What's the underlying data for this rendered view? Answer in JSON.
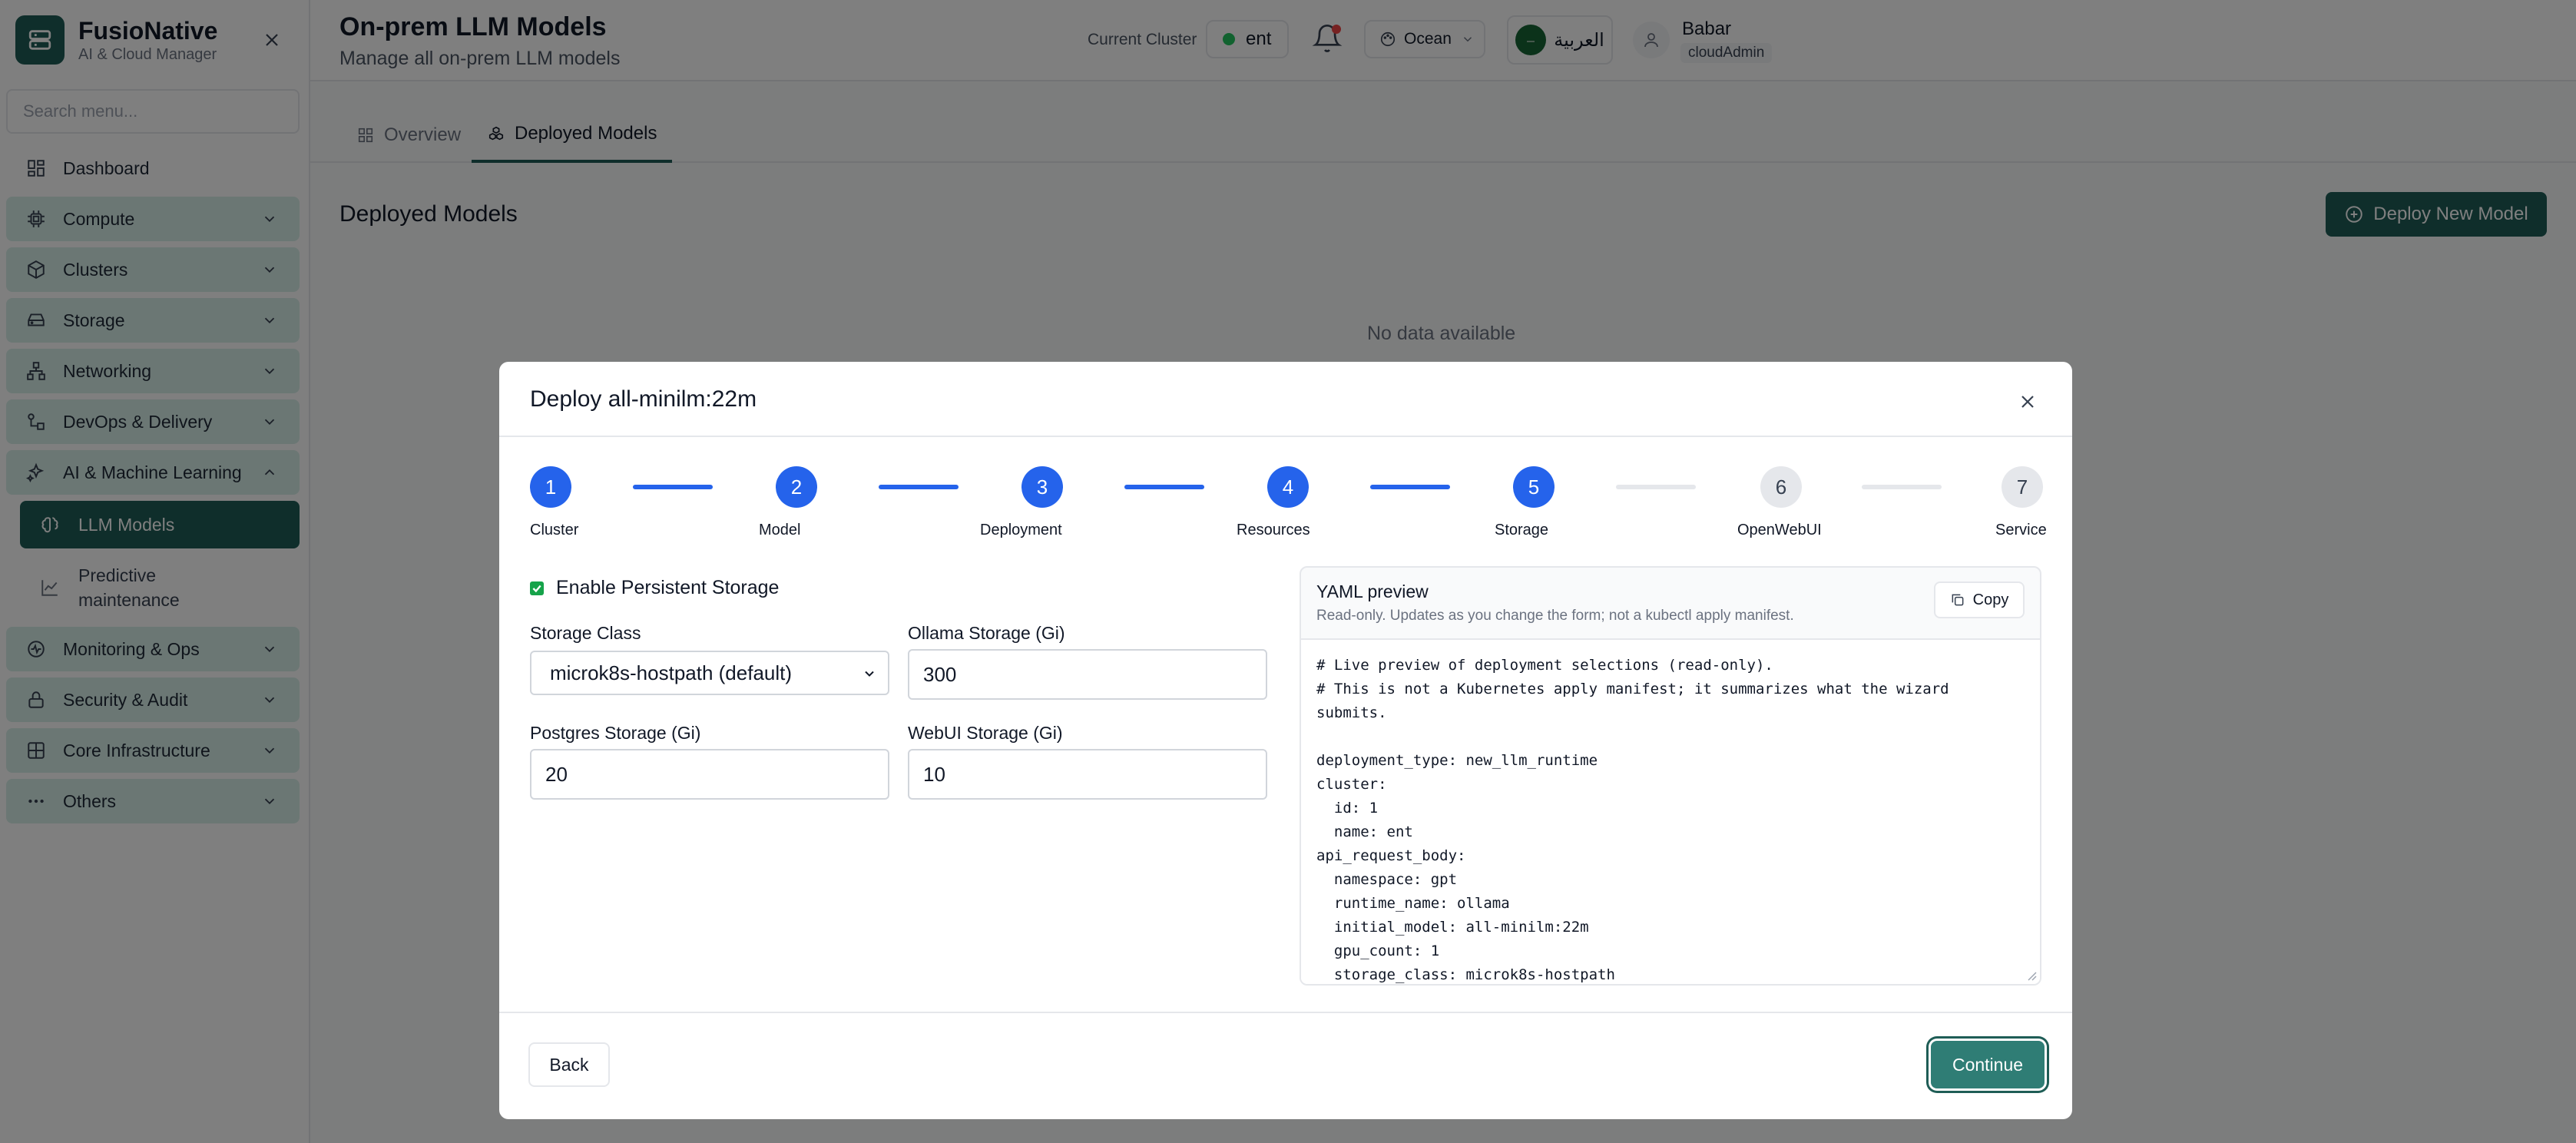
{
  "brand": {
    "name": "FusioNative",
    "subtitle": "AI & Cloud Manager"
  },
  "sidebar": {
    "search_placeholder": "Search menu...",
    "items": [
      {
        "label": "Dashboard",
        "icon": "dashboard-icon"
      },
      {
        "label": "Compute",
        "icon": "cpu-icon"
      },
      {
        "label": "Clusters",
        "icon": "cube-icon"
      },
      {
        "label": "Storage",
        "icon": "hard-drive-icon"
      },
      {
        "label": "Networking",
        "icon": "network-icon"
      },
      {
        "label": "DevOps & Delivery",
        "icon": "devops-icon"
      },
      {
        "label": "AI & Machine Learning",
        "icon": "sparkles-icon"
      },
      {
        "label": "Monitoring & Ops",
        "icon": "activity-icon"
      },
      {
        "label": "Security & Audit",
        "icon": "lock-icon"
      },
      {
        "label": "Core Infrastructure",
        "icon": "server-icon"
      },
      {
        "label": "Others",
        "icon": "more-icon"
      }
    ],
    "sub_active": "LLM Models",
    "sub_other": "Predictive maintenance"
  },
  "header": {
    "title": "On-prem LLM Models",
    "subtitle": "Manage all on-prem LLM models",
    "cluster_label": "Current Cluster",
    "cluster_value": "ent",
    "theme": "Ocean",
    "language": "العربية",
    "user_name": "Babar",
    "user_role": "cloudAdmin"
  },
  "tabs": {
    "overview": "Overview",
    "deployed": "Deployed Models"
  },
  "main": {
    "section_title": "Deployed Models",
    "deploy_button": "Deploy New Model",
    "empty": "No data available"
  },
  "modal": {
    "title": "Deploy all-minilm:22m",
    "steps": [
      {
        "num": "1",
        "label": "Cluster"
      },
      {
        "num": "2",
        "label": "Model"
      },
      {
        "num": "3",
        "label": "Deployment"
      },
      {
        "num": "4",
        "label": "Resources"
      },
      {
        "num": "5",
        "label": "Storage"
      },
      {
        "num": "6",
        "label": "OpenWebUI"
      },
      {
        "num": "7",
        "label": "Service"
      }
    ],
    "enable_storage_label": "Enable Persistent Storage",
    "storage_class_label": "Storage Class",
    "storage_class_value": "microk8s-hostpath (default)",
    "ollama_label": "Ollama Storage (Gi)",
    "ollama_value": "300",
    "postgres_label": "Postgres Storage (Gi)",
    "postgres_value": "20",
    "webui_label": "WebUI Storage (Gi)",
    "webui_value": "10",
    "yaml_title": "YAML preview",
    "yaml_desc": "Read-only. Updates as you change the form; not a kubectl apply manifest.",
    "copy_label": "Copy",
    "yaml_text": "# Live preview of deployment selections (read-only).\n# This is not a Kubernetes apply manifest; it summarizes what the wizard\nsubmits.\n\ndeployment_type: new_llm_runtime\ncluster:\n  id: 1\n  name: ent\napi_request_body:\n  namespace: gpt\n  runtime_name: ollama\n  initial_model: all-minilm:22m\n  gpu_count: 1\n  storage_class: microk8s-hostpath",
    "back_label": "Back",
    "continue_label": "Continue"
  }
}
